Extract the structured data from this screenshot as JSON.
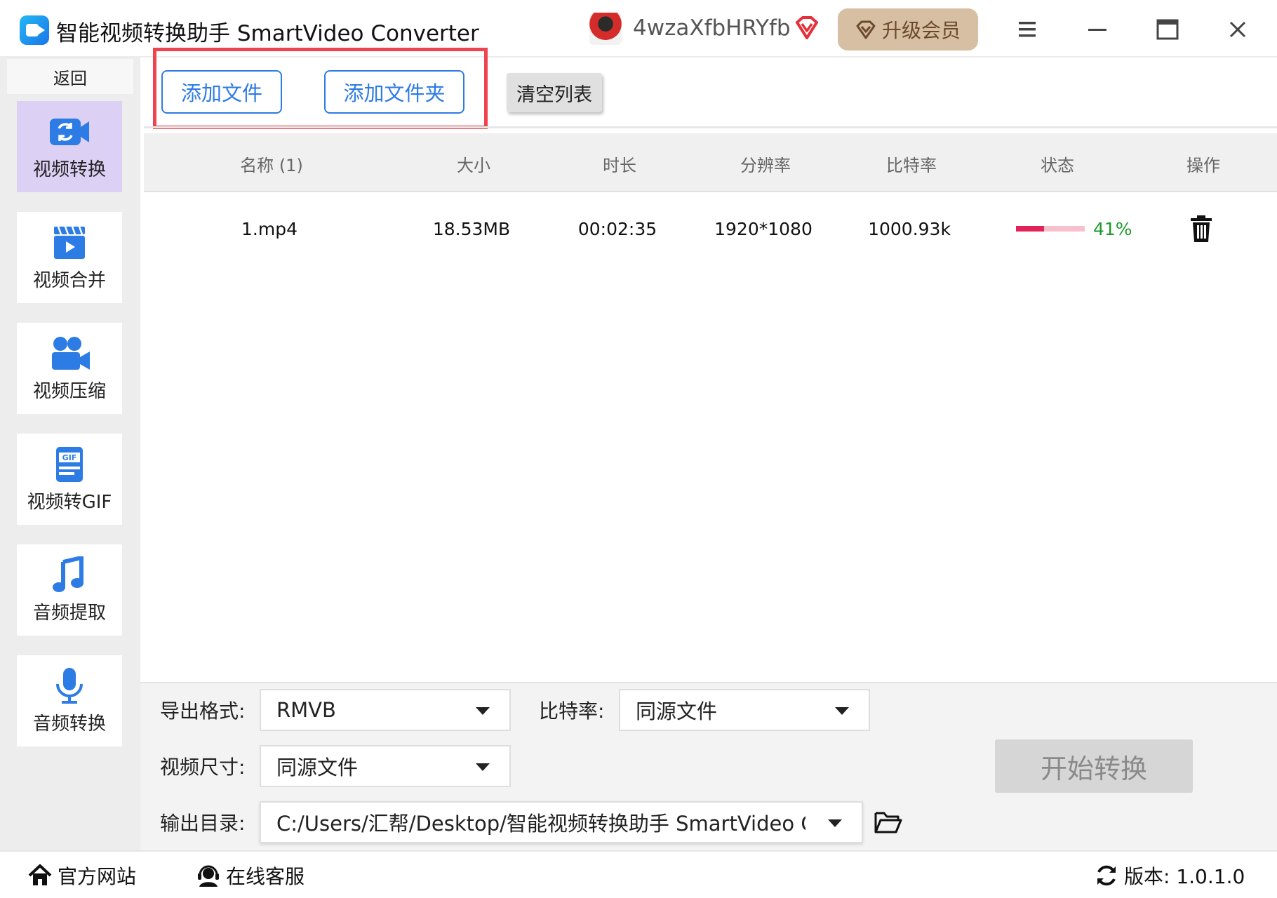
{
  "window": {
    "title": "智能视频转换助手 SmartVideo Converter",
    "user_name": "4wzaXfbHRYfb",
    "upgrade_label": "升级会员"
  },
  "sidebar": {
    "back_label": "返回",
    "items": [
      {
        "label": "视频转换",
        "icon": "video-convert-icon",
        "active": true
      },
      {
        "label": "视频合并",
        "icon": "video-merge-icon",
        "active": false
      },
      {
        "label": "视频压缩",
        "icon": "video-compress-icon",
        "active": false
      },
      {
        "label": "视频转GIF",
        "icon": "gif-icon",
        "active": false
      },
      {
        "label": "音频提取",
        "icon": "music-note-icon",
        "active": false
      },
      {
        "label": "音频转换",
        "icon": "microphone-icon",
        "active": false
      }
    ]
  },
  "toolbar": {
    "add_file_label": "添加文件",
    "add_folder_label": "添加文件夹",
    "clear_list_label": "清空列表"
  },
  "table": {
    "columns": [
      "名称 (1)",
      "大小",
      "时长",
      "分辨率",
      "比特率",
      "状态",
      "操作"
    ],
    "rows": [
      {
        "name": "1.mp4",
        "size": "18.53MB",
        "duration": "00:02:35",
        "resolution": "1920*1080",
        "bitrate": "1000.93k",
        "progress": 0.41,
        "progress_text": "41%"
      }
    ]
  },
  "settings": {
    "format_label": "导出格式:",
    "format_value": "RMVB",
    "bitrate_label": "比特率:",
    "bitrate_value": "同源文件",
    "size_label": "视频尺寸:",
    "size_value": "同源文件",
    "output_label": "输出目录:",
    "output_value": "C:/Users/汇帮/Desktop/智能视频转换助手 SmartVideo Cor",
    "start_label": "开始转换"
  },
  "statusbar": {
    "website_label": "官方网站",
    "support_label": "在线客服",
    "version_label": "版本: 1.0.1.0"
  },
  "colors": {
    "accent": "#2d7be5",
    "highlight_border": "#ee4450",
    "progress_fill": "#e0245a",
    "progress_track": "#f7c0cd",
    "progress_text": "#1f9a2c",
    "active_nav": "#ddd0f5",
    "upgrade_bg": "#d7bfa3"
  }
}
